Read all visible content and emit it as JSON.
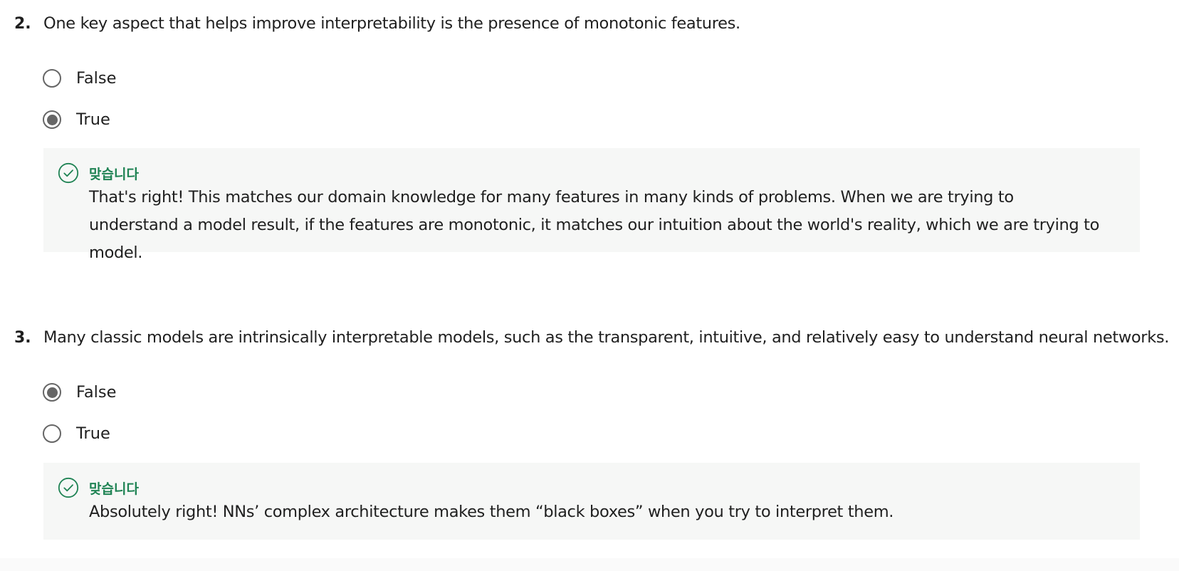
{
  "questions": [
    {
      "number": "2.",
      "text": "One key aspect that helps improve interpretability is the presence of monotonic features.",
      "options": [
        {
          "label": "False",
          "selected": false
        },
        {
          "label": "True",
          "selected": true
        }
      ],
      "feedback": {
        "status": "맞습니다",
        "text": "That's right! This matches our domain knowledge for many features in many kinds of problems. When we are trying to understand a model result, if the features are monotonic, it matches our intuition about the world's reality, which we are trying to model."
      }
    },
    {
      "number": "3.",
      "text": "Many classic models are intrinsically interpretable models, such as the transparent, intuitive, and relatively easy to understand neural networks.",
      "options": [
        {
          "label": "False",
          "selected": true
        },
        {
          "label": "True",
          "selected": false
        }
      ],
      "feedback": {
        "status": "맞습니다",
        "text": "Absolutely right! NNs’ complex architecture makes them “black boxes” when you try to interpret them."
      }
    }
  ],
  "icons": {
    "correct": "check-circle-icon",
    "radio_checked": "radio-checked-icon",
    "radio_unchecked": "radio-unchecked-icon"
  },
  "colors": {
    "correct_green": "#1f8354",
    "feedback_background": "#f6f7f6",
    "radio_gray": "#666666",
    "text": "#1f1f1f"
  }
}
